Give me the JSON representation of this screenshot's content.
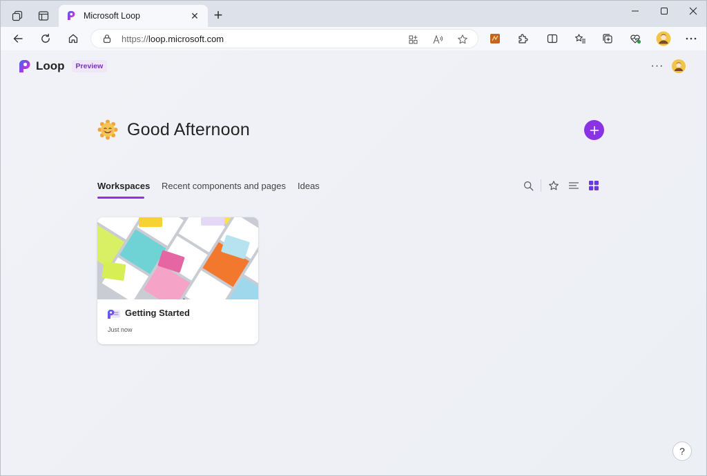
{
  "browser": {
    "tab_title": "Microsoft Loop",
    "tab_close": "✕",
    "new_tab": "+",
    "url_scheme": "https://",
    "url_host": "loop.microsoft.com"
  },
  "app": {
    "brand_name": "Loop",
    "badge": "Preview",
    "more_label": "···",
    "accent_color": "#8a33e3"
  },
  "home": {
    "greeting": "Good Afternoon",
    "tabs": [
      {
        "label": "Workspaces",
        "active": true
      },
      {
        "label": "Recent components and pages",
        "active": false
      },
      {
        "label": "Ideas",
        "active": false
      }
    ]
  },
  "workspaces": [
    {
      "title": "Getting Started",
      "time": "Just now"
    }
  ],
  "help_label": "?"
}
